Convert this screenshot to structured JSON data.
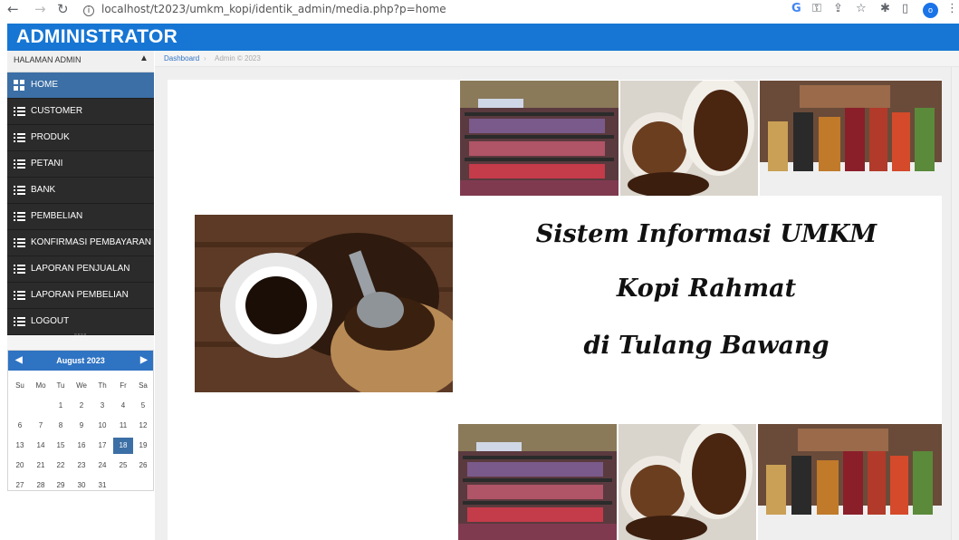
{
  "browser": {
    "url_text": "localhost/t2023/umkm_kopi/identik_admin/media.php?p=home",
    "profile_initial": "o"
  },
  "header": {
    "title": "ADMINISTRATOR",
    "color": "#1776d4"
  },
  "sidebar": {
    "section_label": "HALAMAN ADMIN",
    "menu": [
      {
        "label": "HOME",
        "icon": "dashboard-icon",
        "active": true
      },
      {
        "label": "CUSTOMER",
        "icon": "list-icon"
      },
      {
        "label": "PRODUK",
        "icon": "list-icon"
      },
      {
        "label": "PETANI",
        "icon": "list-icon"
      },
      {
        "label": "BANK",
        "icon": "list-icon"
      },
      {
        "label": "PEMBELIAN",
        "icon": "list-icon"
      },
      {
        "label": "KONFIRMASI PEMBAYARAN",
        "icon": "list-icon"
      },
      {
        "label": "LAPORAN PENJUALAN",
        "icon": "list-icon"
      },
      {
        "label": "LAPORAN PEMBELIAN",
        "icon": "list-icon"
      },
      {
        "label": "LOGOUT",
        "icon": "list-icon"
      }
    ]
  },
  "calendar": {
    "title": "August 2023",
    "days_of_week": [
      "Su",
      "Mo",
      "Tu",
      "We",
      "Th",
      "Fr",
      "Sa"
    ],
    "weeks": [
      [
        "",
        "",
        "1",
        "2",
        "3",
        "4",
        "5"
      ],
      [
        "6",
        "7",
        "8",
        "9",
        "10",
        "11",
        "12"
      ],
      [
        "13",
        "14",
        "15",
        "16",
        "17",
        "18",
        "19"
      ],
      [
        "20",
        "21",
        "22",
        "23",
        "24",
        "25",
        "26"
      ],
      [
        "27",
        "28",
        "29",
        "30",
        "31",
        "",
        ""
      ]
    ],
    "selected_day": "18"
  },
  "breadcrumb": {
    "home": "Dashboard",
    "copyright": "Admin © 2023"
  },
  "main": {
    "title_line1": "Sistem Informasi UMKM",
    "title_line2": "Kopi Rahmat",
    "title_line3": "di Tulang Bawang"
  }
}
